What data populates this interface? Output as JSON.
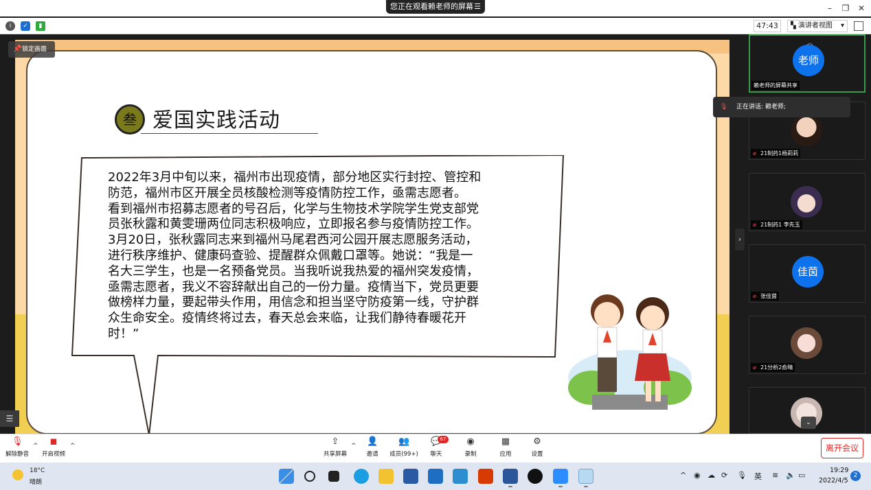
{
  "topbar": {
    "share_banner": "您正在观看赖老师的屏幕",
    "buttons": [
      "minimize",
      "restore",
      "close"
    ]
  },
  "status_strip": {
    "timer": "47:43",
    "view_label": "演讲者视图",
    "icons": [
      "info-icon",
      "shield-icon",
      "signal-icon"
    ]
  },
  "slide": {
    "lock_label": "锁定画面",
    "badge": "叁",
    "title": "爱国实践活动",
    "body_lines": [
      "2022年3月中旬以来，福州市出现疫情，部分地区实行封控、管控和",
      "防范，福州市区开展全员核酸检测等疫情防控工作，亟需志愿者。",
      "看到福州市招募志愿者的号召后，化学与生物技术学院学生党支部党",
      "员张秋露和黄雯珊两位同志积极响应，立即报名参与疫情防控工作。",
      "3月20日，张秋露同志来到福州马尾君西河公园开展志愿服务活动，",
      "进行秩序维护、健康码查验、提醒群众佩戴口罩等。她说：“我是一",
      "名大三学生，也是一名预备党员。当我听说我热爱的福州突发疫情，",
      "亟需志愿者，我义不容辞献出自己的一份力量。疫情当下，党员更要",
      "做榜样力量，要起带头作用，用信念和担当坚守防疫第一线，守护群",
      "众生命安全。疫情终将过去，春天总会来临，让我们静待春暖花开",
      "时！”"
    ]
  },
  "speaker_popup": {
    "text": "正在讲话: 赖老师;"
  },
  "participants": [
    {
      "avatar_text": "老师",
      "name": "赖老师的屏幕共享",
      "type": "initials",
      "active": true
    },
    {
      "avatar_text": "",
      "name": "21制药1杨莉莉",
      "type": "photo"
    },
    {
      "avatar_text": "",
      "name": "21制药1 李先玉",
      "type": "photo"
    },
    {
      "avatar_text": "佳茵",
      "name": "张佳茵",
      "type": "initials"
    },
    {
      "avatar_text": "",
      "name": "21分析2俞晴",
      "type": "photo"
    },
    {
      "avatar_text": "",
      "name": "",
      "type": "photo"
    }
  ],
  "toolbar": {
    "unmute": "解除静音",
    "start_video": "开启视频",
    "share_screen": "共享屏幕",
    "invite": "邀请",
    "members": "成员(99+)",
    "chat": "聊天",
    "chat_count": "67",
    "record": "录制",
    "apps": "应用",
    "settings": "设置",
    "leave": "离开会议"
  },
  "taskbar": {
    "weather_temp": "18°C",
    "weather_cond": "晴朗",
    "ime": "英",
    "time": "19:29",
    "date": "2022/4/5",
    "notifications": "2",
    "colors": {
      "start": "#1f6fd1",
      "edge": "#1b9de2",
      "explorer": "#f2c230",
      "office": "#d83b01",
      "word": "#2b579a"
    }
  }
}
